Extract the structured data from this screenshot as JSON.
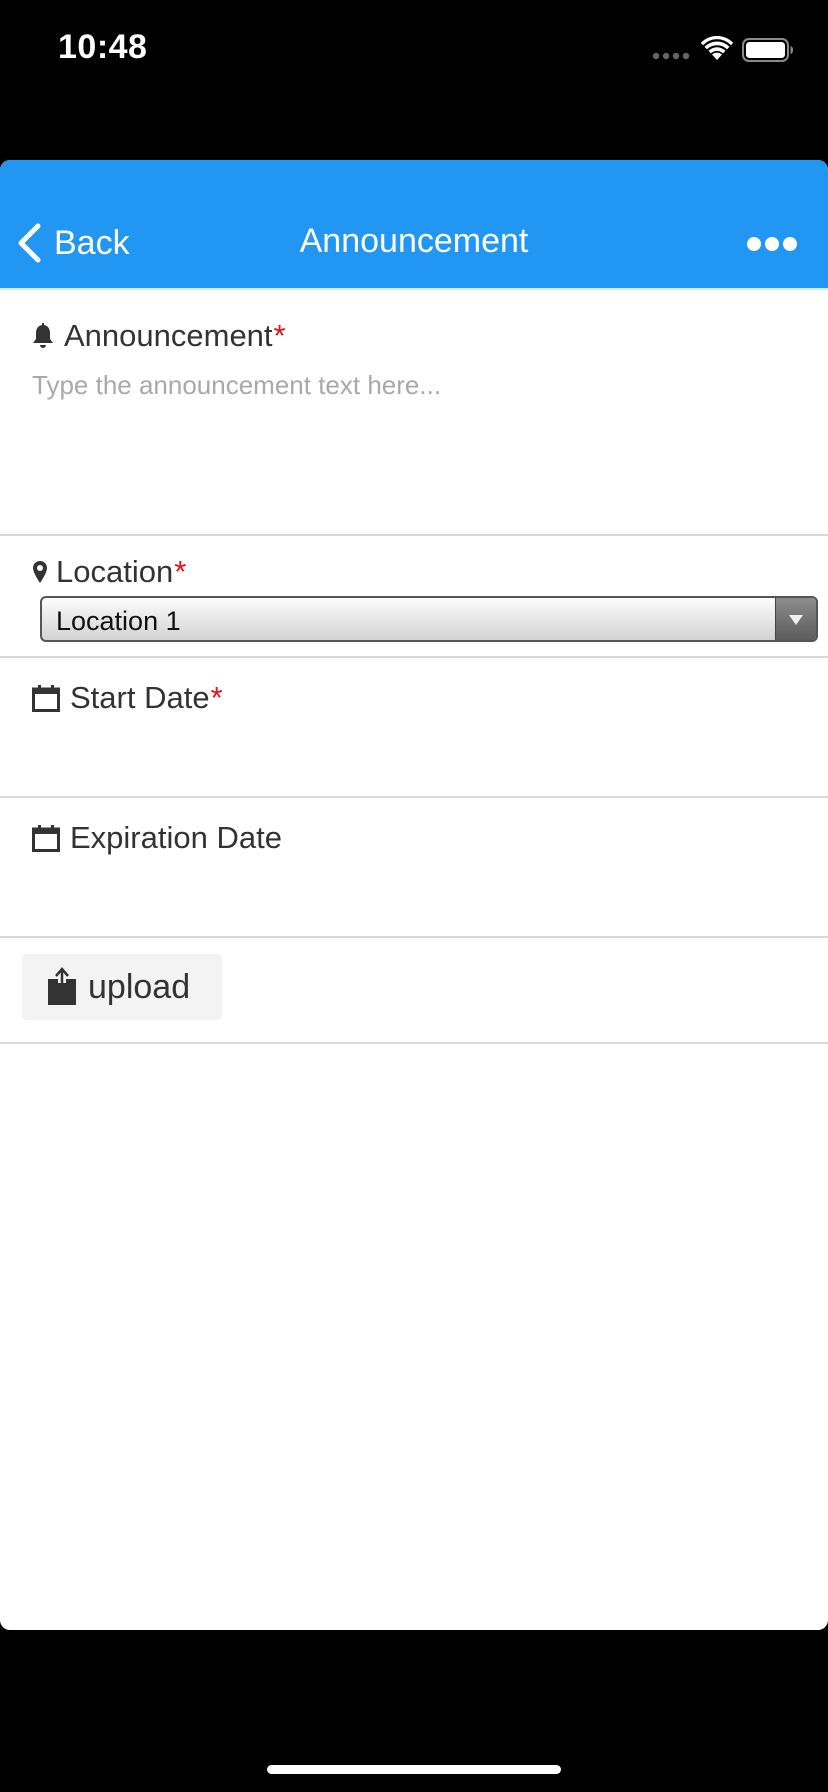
{
  "status_bar": {
    "time": "10:48"
  },
  "nav": {
    "back_label": "Back",
    "title": "Announcement",
    "accent_color": "#2196f3"
  },
  "form": {
    "announcement": {
      "label": "Announcement",
      "required_mark": "*",
      "placeholder": "Type the announcement text here...",
      "icon": "bell-icon"
    },
    "location": {
      "label": "Location",
      "required_mark": "*",
      "selected_value": "Location 1",
      "icon": "map-pin-icon"
    },
    "start_date": {
      "label": "Start Date",
      "required_mark": "*",
      "icon": "calendar-icon"
    },
    "expiration_date": {
      "label": "Expiration Date",
      "icon": "calendar-icon"
    },
    "upload": {
      "label": "upload",
      "icon": "upload-icon"
    }
  },
  "required_color": "#e4101a"
}
